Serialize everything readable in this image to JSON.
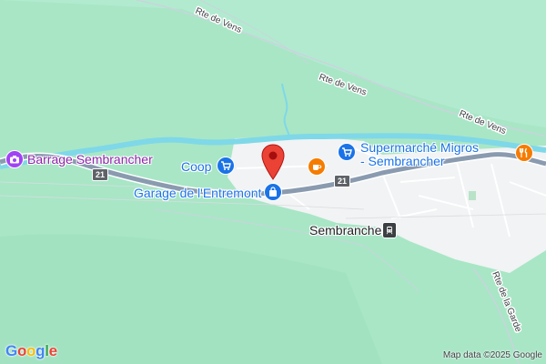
{
  "map": {
    "road_labels": {
      "rte_de_vens_1": "Rte de Vens",
      "rte_de_vens_2": "Rte de Vens",
      "rte_de_vens_3": "Rte de Vens",
      "rte_de_la_garde": "Rte de la Garde"
    },
    "route_number": "21",
    "places": {
      "barrage": "Barrage Sembrancher",
      "coop": "Coop",
      "supermarche_line1": "Supermarché Migros",
      "supermarche_line2": "- Sembrancher",
      "garage": "Garage de l'Entremont",
      "station": "Sembrancher"
    },
    "icons": {
      "barrage": "camera-icon",
      "coop": "shopping-cart-icon",
      "supermarche": "shopping-cart-icon",
      "garage": "shopping-bag-icon",
      "cafe": "coffee-cup-icon",
      "restaurant": "fork-knife-icon",
      "station": "train-icon",
      "pin": "location-pin-icon"
    },
    "colors": {
      "background": "#a8e6c6",
      "river": "#7fd8e8",
      "highway": "#8a9bb0",
      "town": "#f1f3f4",
      "shop_blue": "#1a73e8",
      "place_purple": "#a142f4",
      "food_orange": "#f57c00",
      "pin_red": "#ea4335"
    },
    "logo_text": "Google",
    "attribution": "Map data ©2025 Google"
  }
}
